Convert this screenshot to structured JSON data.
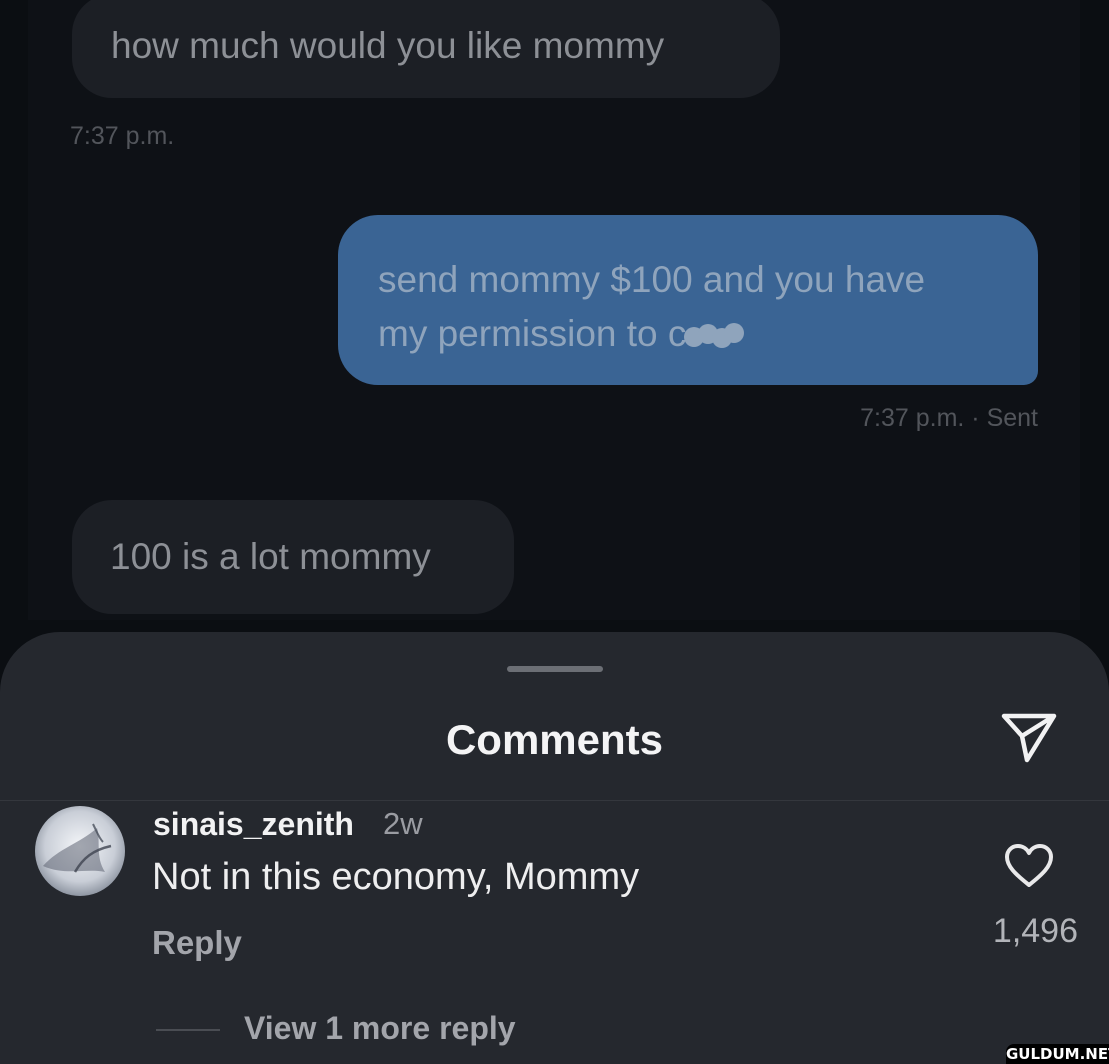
{
  "chat": {
    "messages": [
      {
        "direction": "incoming",
        "text": "how much would you like mommy",
        "time": "7:37 p.m."
      },
      {
        "direction": "outgoing",
        "line1": "send mommy $100 and you have",
        "line2": "my permission to c",
        "line2_redacted": true,
        "status": "7:37 p.m. · Sent",
        "bubble_color": "#3a6494"
      },
      {
        "direction": "incoming",
        "text": "100 is a lot mommy"
      }
    ]
  },
  "comments_sheet": {
    "title": "Comments",
    "share_icon": "paper-plane-icon",
    "comment": {
      "avatar_icon": "avatar-image",
      "username": "sinais_zenith",
      "time_ago": "2w",
      "text": "Not in this economy, Mommy",
      "reply_label": "Reply",
      "like_icon": "heart-outline-icon",
      "like_count": "1,496",
      "view_replies_label": "View 1 more reply"
    }
  },
  "watermark": "GULDUM.NET",
  "colors": {
    "background": "#0b0e12",
    "sheet": "#25282e",
    "incoming_bubble": "#1c1f25",
    "outgoing_bubble": "#3a6494"
  }
}
